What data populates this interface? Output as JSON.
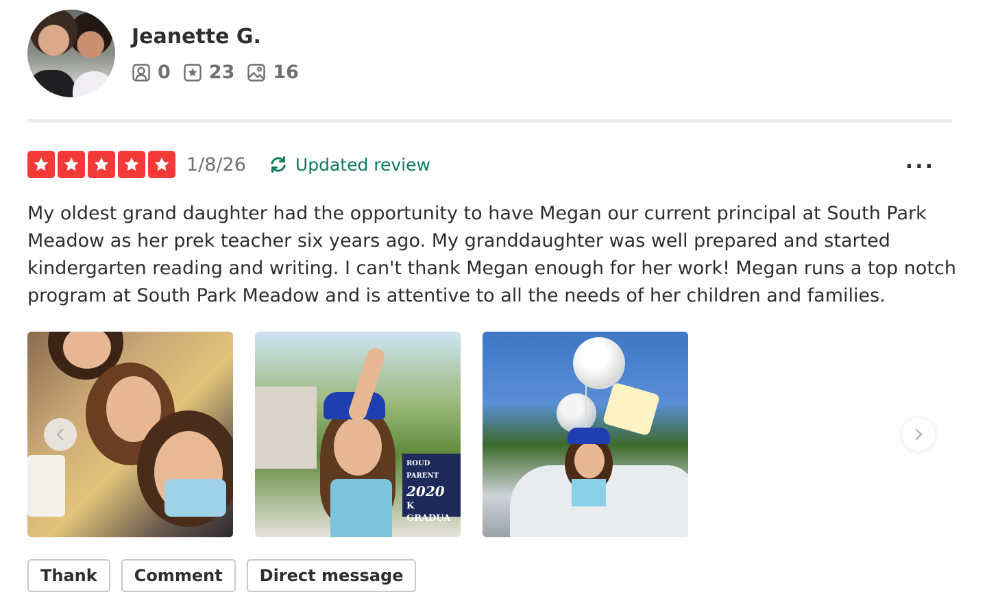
{
  "user": {
    "name": "Jeanette G.",
    "avatar_icon": "user-avatar-photo",
    "stats": {
      "friends": "0",
      "reviews": "23",
      "photos": "16"
    }
  },
  "review": {
    "rating": 5,
    "rating_max": 5,
    "date": "1/8/26",
    "updated_label": "Updated review",
    "more_label": "...",
    "text": "My oldest grand daughter had the opportunity to have Megan our current principal at South Park Meadow as her prek teacher six years ago. My granddaughter was well prepared and started kindergarten reading and writing. I can't thank Megan enough for her work! Megan runs a top notch program at South Park Meadow and is attentive to all the needs of her children and families."
  },
  "photos": [
    {
      "icon": "selfie-photo"
    },
    {
      "icon": "graduate-photo",
      "sign_line1": "ROUD PARENT",
      "sign_line2": "2020",
      "sign_line3": "K GRADUA"
    },
    {
      "icon": "balloons-car-photo"
    }
  ],
  "actions": {
    "thank": "Thank",
    "comment": "Comment",
    "direct_message": "Direct message"
  },
  "colors": {
    "star_red": "#f43939",
    "updated_green": "#0c7a5b",
    "muted_text": "#6e7072"
  }
}
